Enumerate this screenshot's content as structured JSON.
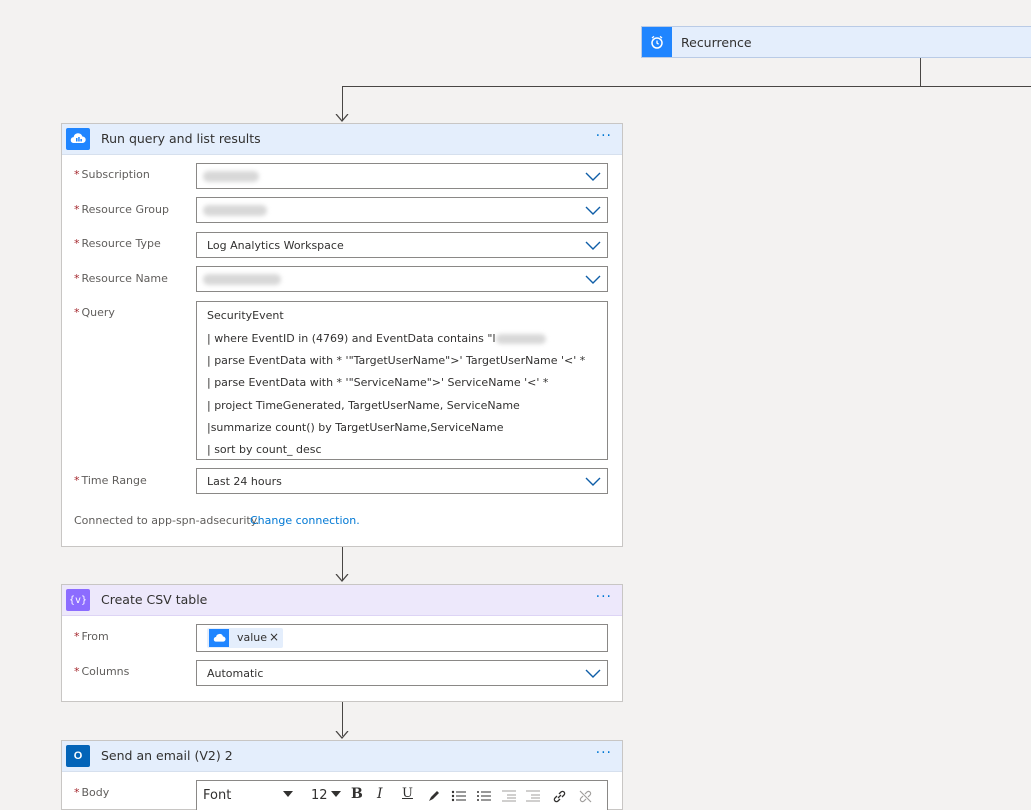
{
  "trigger": {
    "title": "Recurrence",
    "icon": "alarm-clock-icon",
    "color": "#1f85ff"
  },
  "run_query": {
    "title": "Run query and list results",
    "more": "···",
    "fields": [
      {
        "label": "Subscription",
        "value": ""
      },
      {
        "label": "Resource Group",
        "value": ""
      },
      {
        "label": "Resource Type",
        "value": "Log Analytics Workspace"
      },
      {
        "label": "Resource Name",
        "value": ""
      }
    ],
    "query_label": "Query",
    "query_lines": [
      "SecurityEvent",
      "| where EventID in (4769) and EventData contains \"I",
      "| parse EventData with * '\"TargetUserName\">' TargetUserName '<' *",
      "| parse EventData with * '\"ServiceName\">' ServiceName '<' *",
      "| project TimeGenerated, TargetUserName, ServiceName",
      "|summarize count() by TargetUserName,ServiceName",
      "| sort by count_ desc"
    ],
    "time_range_label": "Time Range",
    "time_range_value": "Last 24 hours",
    "connection_text": "Connected to app-spn-adsecurity.",
    "change_connection": "Change connection."
  },
  "csv": {
    "title": "Create CSV table",
    "more": "···",
    "from_label": "From",
    "from_token": "value",
    "columns_label": "Columns",
    "columns_value": "Automatic",
    "color": "#8c6cff"
  },
  "email": {
    "title": "Send an email (V2) 2",
    "more": "···",
    "body_label": "Body",
    "font_value": "Font",
    "size_value": "12",
    "toolbar": {
      "bold": "B",
      "italic": "I",
      "underline": "U"
    }
  }
}
